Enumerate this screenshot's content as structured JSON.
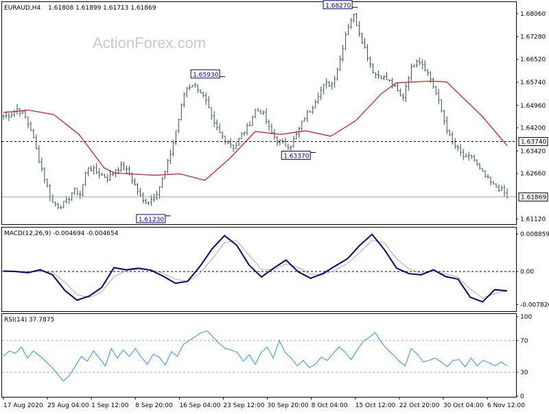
{
  "header": {
    "symbol_label": "EURAUD,H4",
    "ohlc_label": "1.61808 1.61899 1.61713 1.61869"
  },
  "watermark": "ActionForex.com",
  "chart_data": [
    {
      "type": "ohlc",
      "title": "EURAUD,H4",
      "ylim": [
        1.6095,
        1.6845
      ],
      "y_ticks": [
        "1.68060",
        "1.67280",
        "1.66520",
        "1.65740",
        "1.64960",
        "1.64200",
        "1.63420",
        "1.62660",
        "1.61120"
      ],
      "y_tick_values": [
        1.6806,
        1.6728,
        1.6652,
        1.6574,
        1.6496,
        1.642,
        1.6342,
        1.6266,
        1.6112
      ],
      "x_ticks": [
        "17 Aug 2020",
        "25 Aug 04:00",
        "1 Sep 12:00",
        "8 Sep 20:00",
        "16 Sep 04:00",
        "23 Sep 12:00",
        "30 Sep 20:00",
        "8 Oct 04:00",
        "15 Oct 12:00",
        "22 Oct 20:00",
        "30 Oct 04:00",
        "6 Nov 12:00"
      ],
      "close_anchors": [
        1.646,
        1.6465,
        1.6485,
        1.6462,
        1.641,
        1.632,
        1.624,
        1.6168,
        1.6155,
        1.617,
        1.621,
        1.6195,
        1.629,
        1.6275,
        1.6262,
        1.625,
        1.628,
        1.629,
        1.6265,
        1.6215,
        1.617,
        1.6175,
        1.6205,
        1.6262,
        1.6345,
        1.6445,
        1.6552,
        1.6568,
        1.655,
        1.6505,
        1.6435,
        1.6398,
        1.6375,
        1.6352,
        1.6395,
        1.6425,
        1.648,
        1.6475,
        1.6415,
        1.638,
        1.6365,
        1.636,
        1.64,
        1.6455,
        1.6485,
        1.6535,
        1.6568,
        1.657,
        1.6638,
        1.6748,
        1.6805,
        1.6735,
        1.6665,
        1.6602,
        1.6595,
        1.658,
        1.6555,
        1.6515,
        1.6605,
        1.6655,
        1.6635,
        1.6588,
        1.6525,
        1.6445,
        1.6375,
        1.6345,
        1.6315,
        1.6325,
        1.628,
        1.6252,
        1.6225,
        1.6215,
        1.619
      ],
      "ma_anchors": [
        [
          0,
          1.6472
        ],
        [
          0.05,
          1.648
        ],
        [
          0.1,
          1.6465
        ],
        [
          0.15,
          1.6398
        ],
        [
          0.2,
          1.6285
        ],
        [
          0.22,
          1.6268
        ],
        [
          0.3,
          1.626
        ],
        [
          0.35,
          1.6265
        ],
        [
          0.4,
          1.6243
        ],
        [
          0.45,
          1.6318
        ],
        [
          0.5,
          1.6408
        ],
        [
          0.55,
          1.6398
        ],
        [
          0.6,
          1.641
        ],
        [
          0.65,
          1.6392
        ],
        [
          0.7,
          1.6445
        ],
        [
          0.75,
          1.6535
        ],
        [
          0.78,
          1.6572
        ],
        [
          0.85,
          1.6578
        ],
        [
          0.88,
          1.6575
        ],
        [
          0.95,
          1.646
        ],
        [
          1.0,
          1.636
        ]
      ],
      "labels": [
        {
          "text": "1.68270",
          "x": 0.695,
          "value": 1.6827
        },
        {
          "text": "1.65930",
          "x": 0.432,
          "value": 1.6593
        },
        {
          "text": "1.63370",
          "x": 0.612,
          "value": 1.6337
        },
        {
          "text": "1.61230",
          "x": 0.324,
          "value": 1.6123
        }
      ],
      "hlines": [
        {
          "value": 1.6374,
          "label": "1.63740",
          "style": "dashed"
        },
        {
          "value": 1.61869,
          "label": "1.61869",
          "style": "solid"
        }
      ]
    },
    {
      "type": "line",
      "title": "MACD(12,26,9) -0.004694 -0.004654",
      "ylim": [
        -0.0094,
        0.0104
      ],
      "y_ticks": [
        "0.008859",
        "0.00",
        "-0.007826"
      ],
      "y_tick_values": [
        0.008859,
        0.0,
        -0.007826
      ],
      "series": [
        {
          "values": [
            0.0001,
            0.0,
            -0.0003,
            0.0004,
            -0.0008,
            -0.0045,
            -0.0068,
            -0.0058,
            -0.0038,
            0.0009,
            0.0004,
            0.0008,
            0.0003,
            -0.0011,
            -0.0028,
            -0.0023,
            0.0012,
            0.0054,
            0.0085,
            0.0062,
            0.0015,
            -0.0013,
            0.0008,
            0.0027,
            -0.0001,
            -0.0016,
            -0.0005,
            0.0013,
            0.003,
            0.0062,
            0.0088,
            0.0052,
            0.0008,
            -0.0005,
            -0.0008,
            0.0004,
            -0.0012,
            -0.0018,
            -0.0061,
            -0.0072,
            -0.0043,
            -0.0046
          ]
        },
        {
          "values": [
            0.0002,
            0.0001,
            -0.0001,
            0.0001,
            -0.0002,
            -0.0025,
            -0.0055,
            -0.0062,
            -0.0048,
            -0.0012,
            0.0002,
            0.0005,
            0.0004,
            -0.0004,
            -0.0018,
            -0.0024,
            -0.0004,
            0.003,
            0.0068,
            0.0074,
            0.0038,
            0.0005,
            0.0004,
            0.0018,
            0.0009,
            -0.0006,
            -0.0007,
            0.0003,
            0.0019,
            0.0045,
            0.0074,
            0.0068,
            0.003,
            0.0006,
            -0.0004,
            0.0,
            -0.0006,
            -0.0013,
            -0.0042,
            -0.0063,
            -0.0052,
            -0.0046
          ]
        }
      ],
      "colors": [
        "#000080",
        "#c0a0a0"
      ]
    },
    {
      "type": "line",
      "title": "RSI(14) 37.7875",
      "ylim": [
        0,
        100
      ],
      "y_ticks": [
        "100",
        "70",
        "30",
        "0"
      ],
      "y_tick_values": [
        100,
        70,
        30,
        0
      ],
      "hlines": [
        70,
        30
      ],
      "series": [
        {
          "values": [
            50,
            57,
            54,
            62,
            48,
            57,
            51,
            44,
            37,
            28,
            19,
            26,
            38,
            50,
            44,
            57,
            48,
            38,
            60,
            48,
            58,
            50,
            60,
            49,
            40,
            53,
            49,
            39,
            56,
            50,
            65,
            70,
            75,
            80,
            82,
            74,
            66,
            60,
            58,
            55,
            44,
            52,
            40,
            55,
            62,
            48,
            70,
            55,
            48,
            38,
            45,
            36,
            40,
            49,
            45,
            54,
            62,
            55,
            46,
            58,
            69,
            74,
            80,
            68,
            59,
            52,
            44,
            38,
            60,
            53,
            43,
            45,
            48,
            43,
            37,
            45,
            46,
            37,
            48,
            38,
            45,
            42,
            38,
            43,
            38
          ]
        }
      ],
      "colors": [
        "#1e90ff"
      ]
    }
  ],
  "colors": {
    "candles": "#2f4f4f",
    "ma": "#d01010",
    "macd": "#000080",
    "signal": "#c0a0a0",
    "rsi": "#1e90ff",
    "label_border": "#000080",
    "grid_dash": "#000000",
    "rsi_levels": "#a0a0a0"
  }
}
